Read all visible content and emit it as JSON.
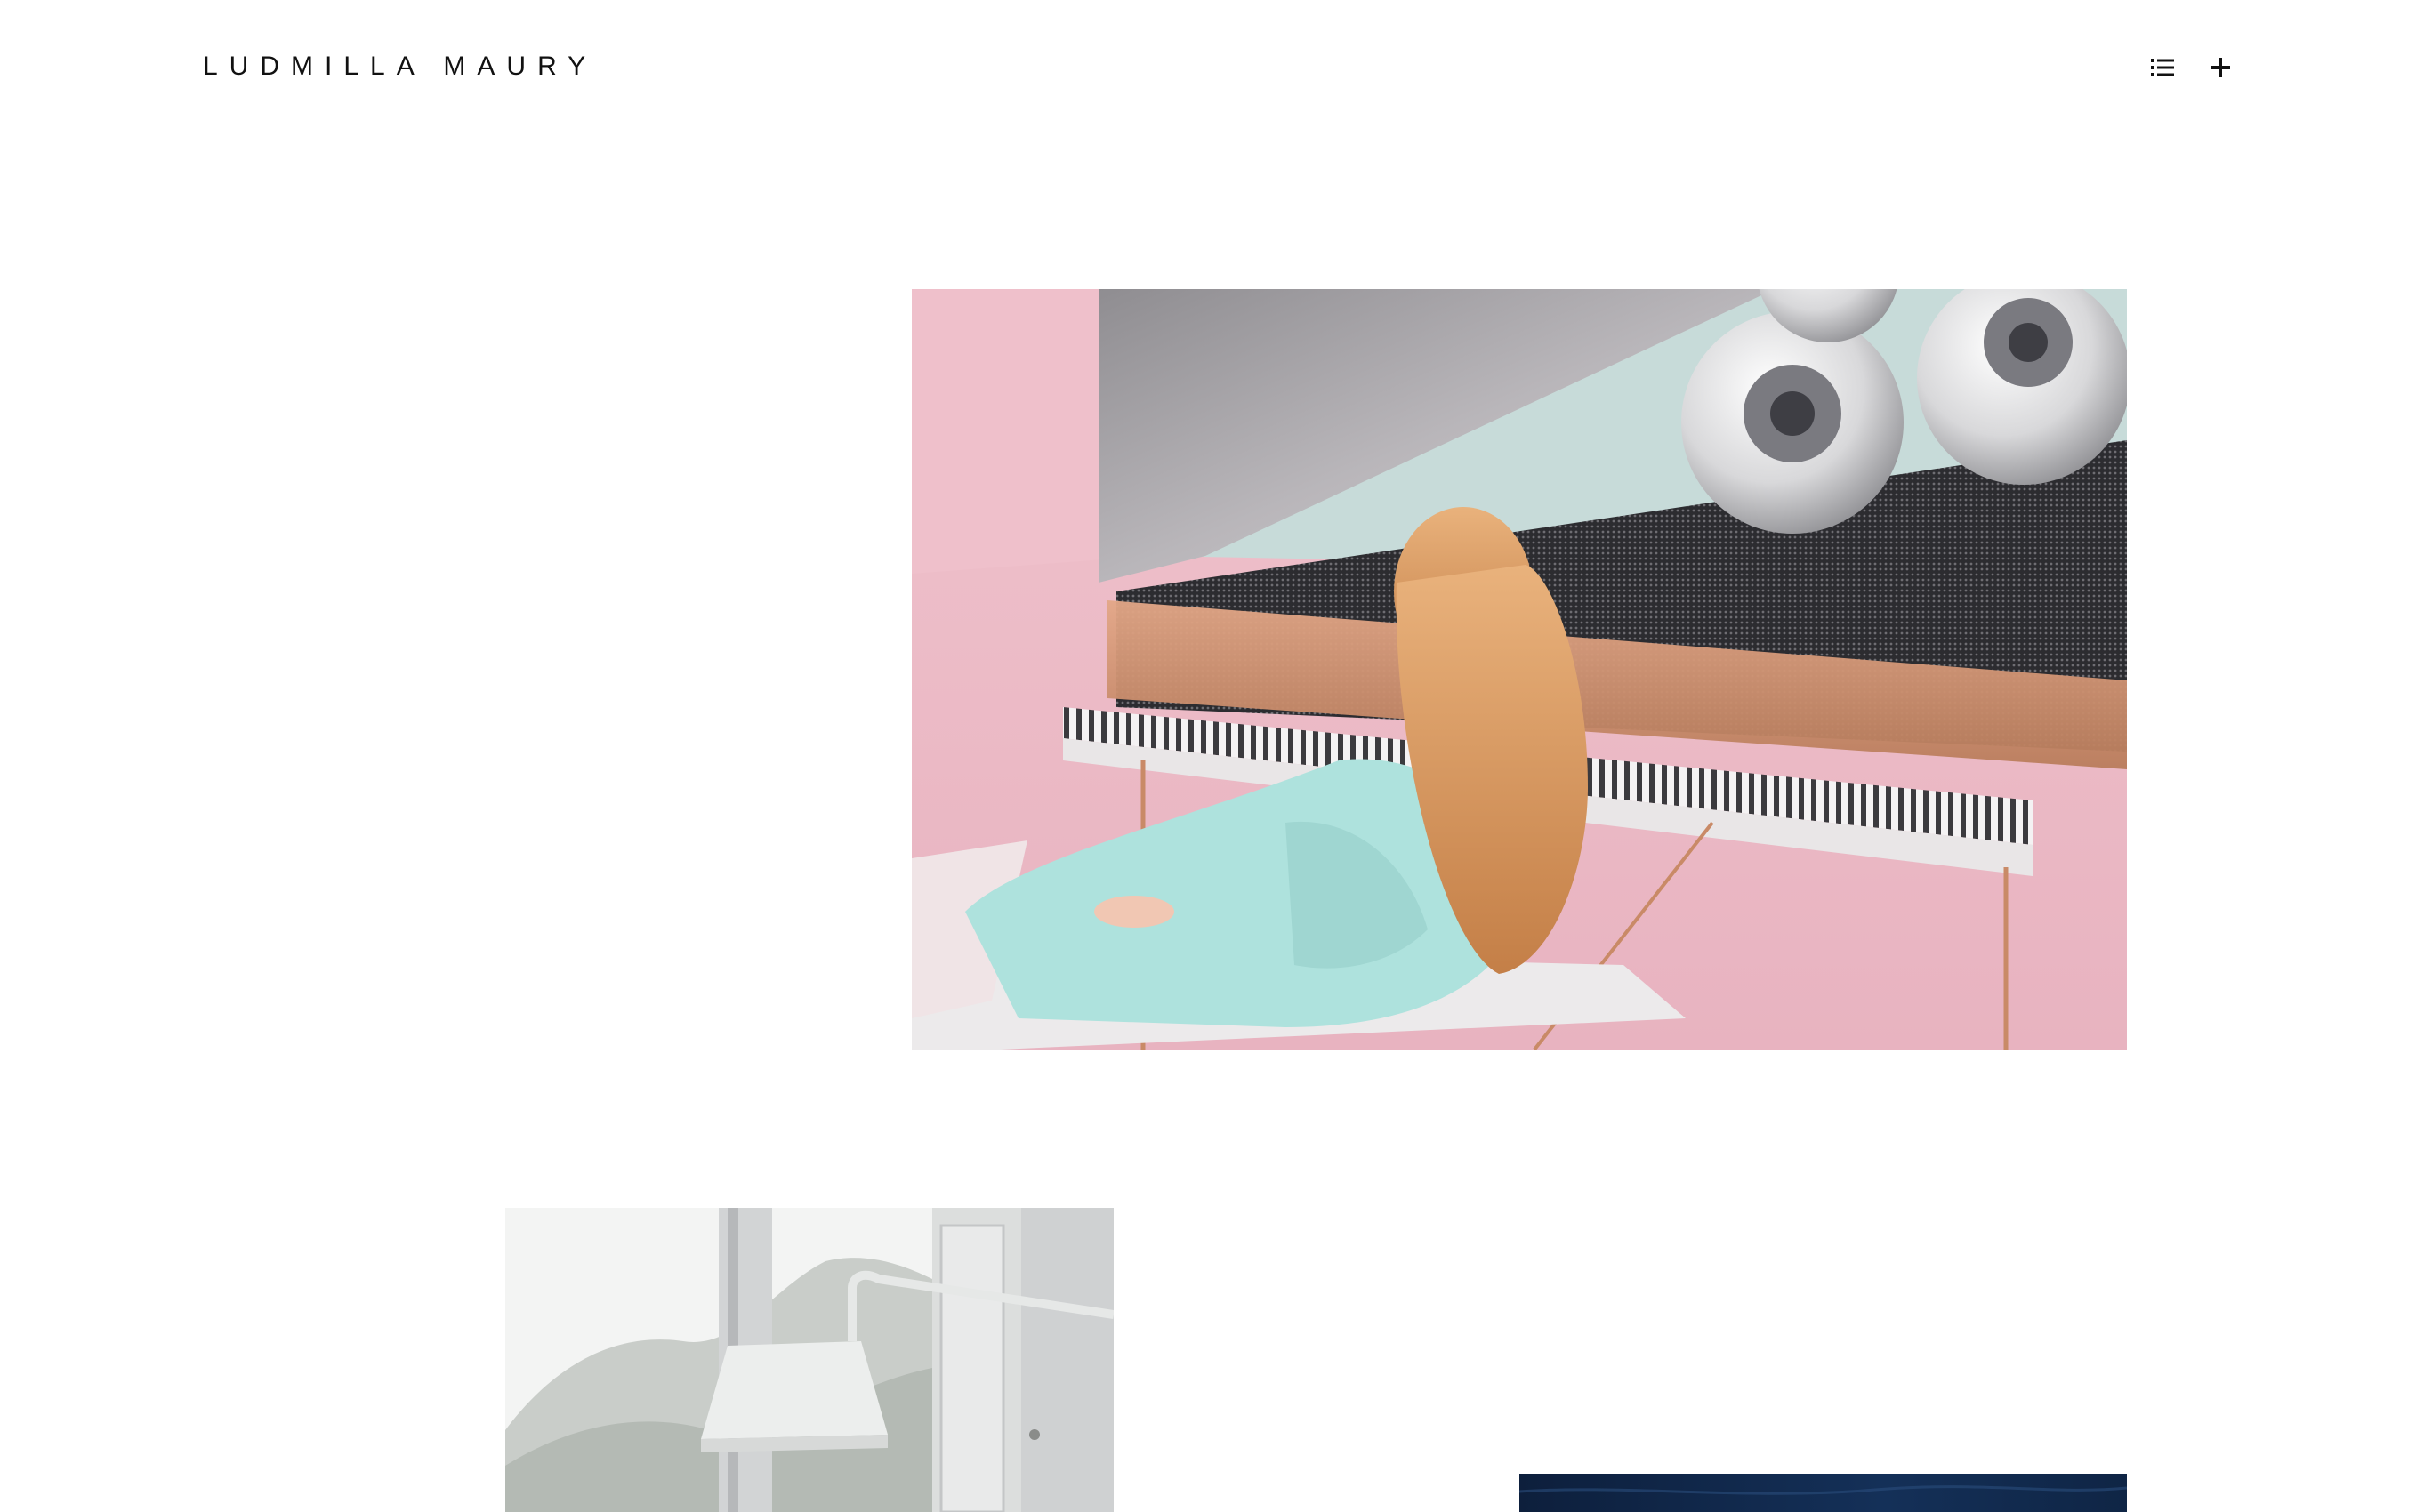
{
  "header": {
    "site_title": "LUDMILLA MAURY",
    "list_icon": "list-icon",
    "plus_icon": "plus-icon"
  },
  "projects": [
    {
      "image": "piano-woman-image",
      "colors": {
        "background": "#eebcc8",
        "sweater": "#aee2dd",
        "hair": "#d9965c",
        "copper": "#cc8d6c"
      }
    },
    {
      "image": "lamp-window-image",
      "colors": {
        "wall": "#f2f3f2",
        "frame": "#c9cbcc",
        "lamp": "#eaeceb"
      }
    },
    {
      "image": "ocean-image",
      "colors": {
        "water": "#0f2545"
      }
    }
  ]
}
